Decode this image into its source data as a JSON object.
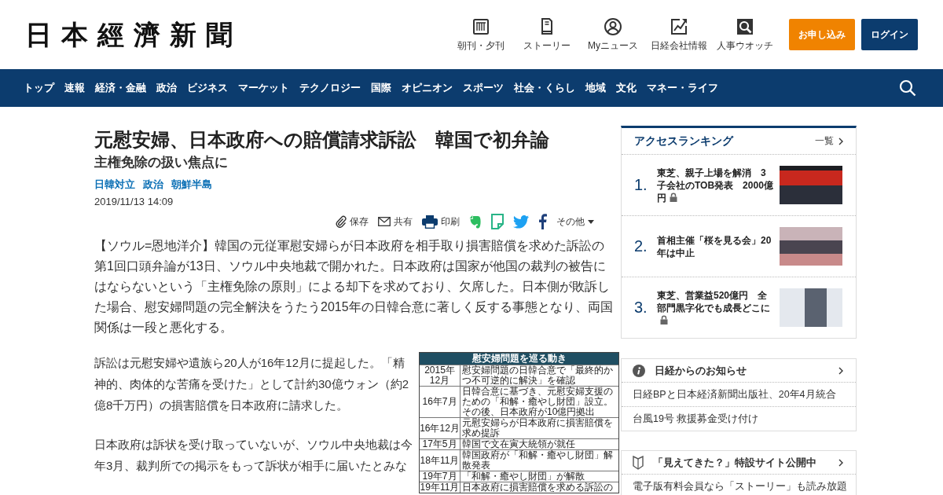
{
  "header": {
    "logo": "日本經濟新聞",
    "links": [
      {
        "kind": "paper",
        "label": "朝刊・夕刊"
      },
      {
        "kind": "story",
        "label": "ストーリー"
      },
      {
        "kind": "my",
        "label": "Myニュース"
      },
      {
        "kind": "company",
        "label": "日経会社情報"
      },
      {
        "kind": "watch",
        "label": "人事ウオッチ"
      }
    ],
    "buttons": [
      {
        "kind": "primary",
        "label": "お申し込み"
      },
      {
        "kind": "secondary",
        "label": "ログイン"
      }
    ]
  },
  "nav": {
    "items": [
      "トップ",
      "速報",
      "経済・金融",
      "政治",
      "ビジネス",
      "マーケット",
      "テクノロジー",
      "国際",
      "オピニオン",
      "スポーツ",
      "社会・くらし",
      "地域",
      "文化",
      "マネー・ライフ"
    ]
  },
  "article": {
    "title": "元慰安婦、日本政府への賠償請求訴訟　韓国で初弁論",
    "subtitle": "主権免除の扱い焦点に",
    "tags": [
      "日韓対立",
      "政治",
      "朝鮮半島"
    ],
    "date": "2019/11/13 14:09",
    "share": [
      {
        "kind": "save",
        "label": "保存"
      },
      {
        "kind": "mail",
        "label": "共有"
      },
      {
        "kind": "print",
        "label": "印刷"
      },
      {
        "kind": "evernote"
      },
      {
        "kind": "note"
      },
      {
        "kind": "twitter"
      },
      {
        "kind": "facebook"
      },
      {
        "kind": "more",
        "label": "その他"
      }
    ],
    "body": [
      {
        "kind": "paragraph",
        "text": "【ソウル=恩地洋介】韓国の元従軍慰安婦らが日本政府を相手取り損害賠償を求めた訴訟の第1回口頭弁論が13日、ソウル中央地裁で開かれた。日本政府は国家が他国の裁判の被告にはならないという「主権免除の原則」による却下を求めており、欠席した。日本側が敗訴した場合、慰安婦問題の完全解決をうたう2015年の日韓合意に著しく反する事態となり、両国関係は一段と悪化する。"
      },
      {
        "kind": "wrap",
        "paragraphs": [
          "訴訟は元慰安婦や遺族ら20人が16年12月に提起した。「精神的、肉体的な苦痛を受けた」として計約30億ウォン（約2億8千万円）の損害賠償を日本政府に請求した。",
          "日本政府は訴状を受け取っていないが、ソウル中央地裁は今年3月、裁判所での掲示をもって訴状が相手に届いたとみな"
        ],
        "inset": {
          "title": "慰安婦問題を巡る動き",
          "rows": [
            {
              "date": "2015年12月",
              "event": "慰安婦問題の日韓合意で「最終的かつ不可逆的に解決」を確認"
            },
            {
              "date": "16年7月",
              "event": "日韓合意に基づき、元慰安婦支援のための「和解・癒やし財団」設立。その後、日本政府が10億円拠出"
            },
            {
              "date": "16年12月",
              "event": "元慰安婦らが日本政府に損害賠償を求め提訴"
            },
            {
              "date": "17年5月",
              "event": "韓国で文在寅大統領が就任"
            },
            {
              "date": "18年11月",
              "event": "韓国政府が「和解・癒やし財団」解散発表"
            },
            {
              "date": "19年7月",
              "event": "「和解・癒やし財団」が解散"
            },
            {
              "date": "19年11月",
              "event": "日本政府に損害賠償を求める訴訟の"
            }
          ]
        }
      }
    ]
  },
  "sidebar": {
    "ranking": {
      "title": "アクセスランキング",
      "more": "一覧",
      "items": [
        {
          "rank": "1.",
          "title": "東芝、親子上場を解消　3子会社のTOB発表　2000億円",
          "locked": true
        },
        {
          "rank": "2.",
          "title": "首相主催「桜を見る会」20年は中止",
          "locked": false
        },
        {
          "rank": "3.",
          "title": "東芝、営業益520億円　全部門黒字化でも成長どこに",
          "locked": true
        }
      ]
    },
    "notices": [
      {
        "kind": "info",
        "title": "日経からのお知らせ",
        "items": [
          "日経BPと日本経済新聞出版社、20年4月統合",
          "台風19号 救援募金受け付け"
        ]
      },
      {
        "kind": "beginner",
        "title": "「見えてきた？」特設サイト公開中",
        "items": [
          "電子版有料会員なら「ストーリー」も読み放題"
        ]
      }
    ]
  }
}
